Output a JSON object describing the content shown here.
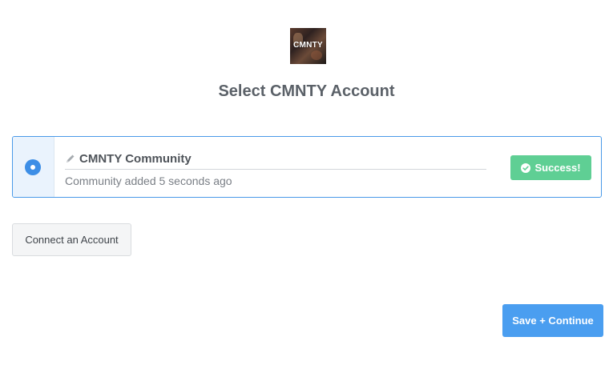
{
  "app": {
    "logo_text": "CMNTY",
    "logo_icon": "cmnty-app-logo"
  },
  "page": {
    "title": "Select CMNTY Account"
  },
  "account": {
    "selected": true,
    "name": "CMNTY Community",
    "subtitle": "Community added 5 seconds ago",
    "edit_icon": "pencil-icon",
    "status_label": "Success!",
    "status_icon": "check-circle-icon",
    "status_color": "#5fcf94"
  },
  "actions": {
    "connect_label": "Connect an Account",
    "save_label": "Save + Continue",
    "primary_color": "#4a9ef0",
    "selection_color": "#3d8ee6"
  }
}
